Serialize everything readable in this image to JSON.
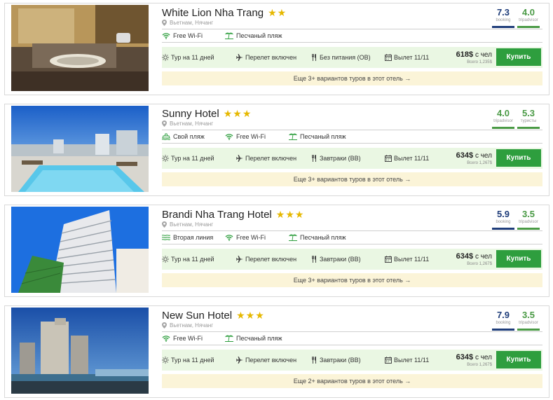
{
  "colors": {
    "accent_green": "#2e9e3e",
    "booking_blue": "#1f3d7a",
    "tripadvisor_green": "#4a9a45",
    "tour_row_bg": "#eaf7e3",
    "more_row_bg": "#fbf4d8",
    "star_gold": "#e6b800"
  },
  "hotels": [
    {
      "name": "White Lion Nha Trang",
      "stars": 2,
      "location": "Вьетнам, Нячанг",
      "photo_icon": "bathroom-photo",
      "features": [
        {
          "icon": "wifi-icon",
          "label": "Free Wi-Fi"
        },
        {
          "icon": "beach-icon",
          "label": "Песчаный пляж"
        }
      ],
      "tour": {
        "duration": "Тур на 11 дней",
        "flight": "Перелет включен",
        "meals": "Без питания (OB)",
        "departure": "Вылет 11/11"
      },
      "price": {
        "main": "618$",
        "suffix": "с чел",
        "total": "Всего 1,235$"
      },
      "buy_label": "Купить",
      "more_label": "Еще 3+ вариантов туров в этот отель →",
      "ratings": [
        {
          "value": "7.3",
          "source": "booking",
          "color": "#1f3d7a"
        },
        {
          "value": "4.0",
          "source": "tripadvisor",
          "color": "#4a9a45"
        }
      ]
    },
    {
      "name": "Sunny Hotel",
      "stars": 3,
      "location": "Вьетнам, Нячанг",
      "photo_icon": "rooftop-pool-photo",
      "features": [
        {
          "icon": "own-beach-icon",
          "label": "Свой пляж"
        },
        {
          "icon": "wifi-icon",
          "label": "Free Wi-Fi"
        },
        {
          "icon": "beach-icon",
          "label": "Песчаный пляж"
        }
      ],
      "tour": {
        "duration": "Тур на 11 дней",
        "flight": "Перелет включен",
        "meals": "Завтраки (BB)",
        "departure": "Вылет 11/11"
      },
      "price": {
        "main": "634$",
        "suffix": "с чел",
        "total": "Всего 1,267$"
      },
      "buy_label": "Купить",
      "more_label": "Еще 3+ вариантов туров в этот отель →",
      "ratings": [
        {
          "value": "4.0",
          "source": "tripadvisor",
          "color": "#4a9a45"
        },
        {
          "value": "5.3",
          "source": "туристы",
          "color": "#4a9a45"
        }
      ]
    },
    {
      "name": "Brandi Nha Trang Hotel",
      "stars": 3,
      "location": "Вьетнам, Нячанг",
      "photo_icon": "tower-photo",
      "features": [
        {
          "icon": "second-line-icon",
          "label": "Вторая линия"
        },
        {
          "icon": "wifi-icon",
          "label": "Free Wi-Fi"
        },
        {
          "icon": "beach-icon",
          "label": "Песчаный пляж"
        }
      ],
      "tour": {
        "duration": "Тур на 11 дней",
        "flight": "Перелет включен",
        "meals": "Завтраки (BB)",
        "departure": "Вылет 11/11"
      },
      "price": {
        "main": "634$",
        "suffix": "с чел",
        "total": "Всего 1,267$"
      },
      "buy_label": "Купить",
      "more_label": "Еще 3+ вариантов туров в этот отель →",
      "ratings": [
        {
          "value": "5.9",
          "source": "booking",
          "color": "#1f3d7a"
        },
        {
          "value": "3.5",
          "source": "tripadvisor",
          "color": "#4a9a45"
        }
      ]
    },
    {
      "name": "New Sun Hotel",
      "stars": 3,
      "location": "Вьетнам, Нячанг",
      "photo_icon": "city-skyline-photo",
      "features": [
        {
          "icon": "wifi-icon",
          "label": "Free Wi-Fi"
        },
        {
          "icon": "beach-icon",
          "label": "Песчаный пляж"
        }
      ],
      "tour": {
        "duration": "Тур на 11 дней",
        "flight": "Перелет включен",
        "meals": "Завтраки (BB)",
        "departure": "Вылет 11/11"
      },
      "price": {
        "main": "634$",
        "suffix": "с чел",
        "total": "Всего 1,267$"
      },
      "buy_label": "Купить",
      "more_label": "Еще 2+ вариантов туров в этот отель →",
      "ratings": [
        {
          "value": "7.9",
          "source": "booking",
          "color": "#1f3d7a"
        },
        {
          "value": "3.5",
          "source": "tripadvisor",
          "color": "#4a9a45"
        }
      ]
    }
  ]
}
